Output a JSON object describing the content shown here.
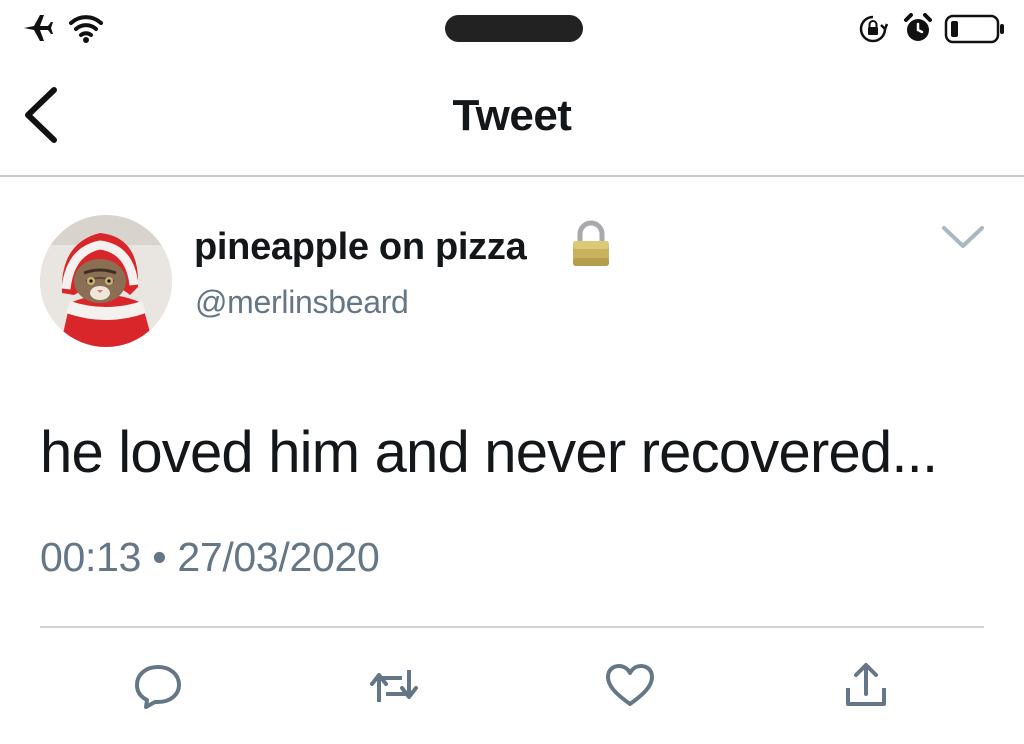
{
  "nav": {
    "title": "Tweet"
  },
  "tweet": {
    "display_name": "pineapple on pizza",
    "handle": "@merlinsbeard",
    "text": "he loved him and never recovered...",
    "timestamp": "00:13 • 27/03/2020",
    "protected": true
  },
  "icons": {
    "status": [
      "airplane-mode-icon",
      "wifi-icon",
      "rotation-lock-icon",
      "alarm-icon",
      "battery-icon"
    ],
    "actions": [
      "reply-icon",
      "retweet-icon",
      "like-icon",
      "share-icon"
    ]
  },
  "colors": {
    "secondary_text": "#657786",
    "icon_gray": "#657786",
    "lock_gold": "#c9b25e"
  }
}
